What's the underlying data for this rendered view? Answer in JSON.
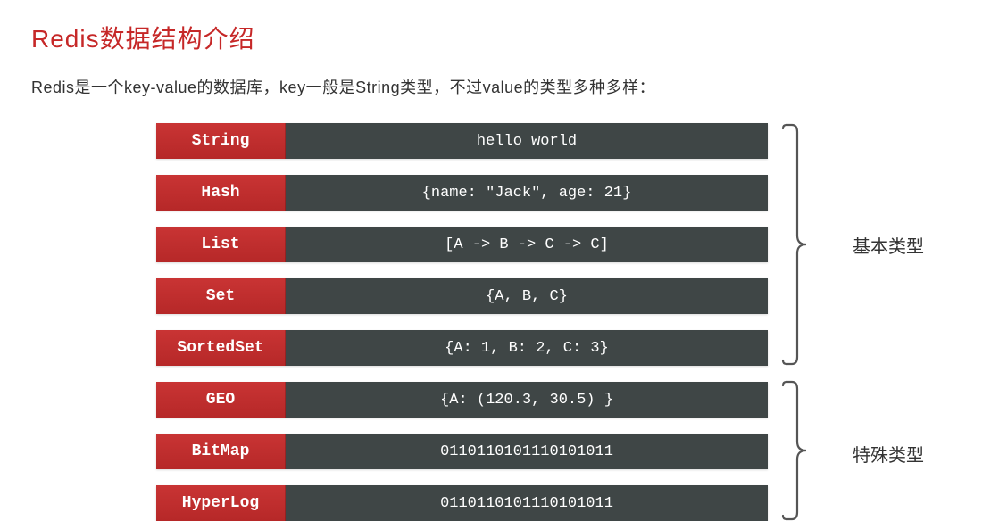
{
  "title": "Redis数据结构介绍",
  "subtitle": "Redis是一个key-value的数据库，key一般是String类型，不过value的类型多种多样：",
  "rows": [
    {
      "type": "String",
      "value": "hello world"
    },
    {
      "type": "Hash",
      "value": "{name: \"Jack\", age: 21}"
    },
    {
      "type": "List",
      "value": "[A -> B -> C -> C]"
    },
    {
      "type": "Set",
      "value": "{A, B, C}"
    },
    {
      "type": "SortedSet",
      "value": "{A: 1, B: 2, C: 3}"
    },
    {
      "type": "GEO",
      "value": "{A: (120.3,  30.5) }"
    },
    {
      "type": "BitMap",
      "value": "0110110101110101011"
    },
    {
      "type": "HyperLog",
      "value": "0110110101110101011"
    }
  ],
  "groups": {
    "basic_label": "基本类型",
    "special_label": "特殊类型"
  }
}
